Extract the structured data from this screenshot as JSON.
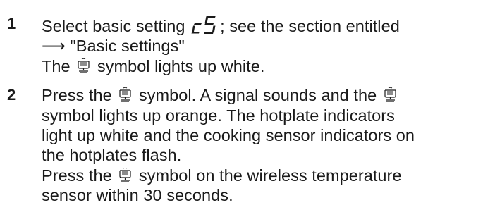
{
  "steps": [
    {
      "number": "1",
      "line1": {
        "before": "Select basic setting",
        "setting_code": "c 5",
        "after": "; see the section entitled"
      },
      "line2": {
        "arrow": "⟶",
        "text": "\"Basic settings\""
      },
      "line3": {
        "before": "The",
        "after": "symbol lights up white."
      }
    },
    {
      "number": "2",
      "line1": {
        "before": "Press the",
        "after": "symbol. A signal sounds and the"
      },
      "line2": "symbol lights up orange. The hotplate indicators",
      "line3": "light up white and the cooking sensor indicators on",
      "line4": "the hotplates flash.",
      "line5": {
        "before": "Press the",
        "after": "symbol on the wireless temperature"
      },
      "line6": "sensor within 30 seconds."
    }
  ],
  "icons": {
    "symbol": "cooking-sensor-icon",
    "display": "seven-segment-display"
  }
}
